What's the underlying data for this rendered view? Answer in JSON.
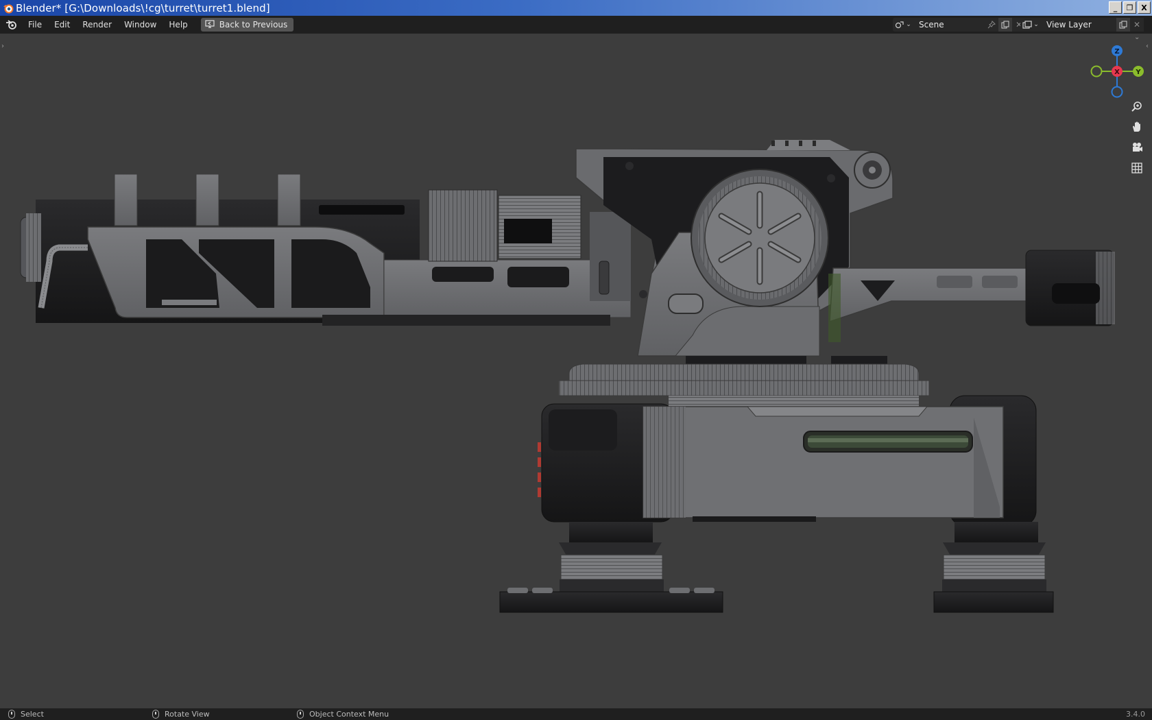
{
  "window": {
    "title": "Blender* [G:\\Downloads\\!cg\\turret\\turret1.blend]",
    "controls": {
      "minimize": "_",
      "restore": "❐",
      "close": "X"
    }
  },
  "topbar": {
    "menus": [
      "File",
      "Edit",
      "Render",
      "Window",
      "Help"
    ],
    "back_button": "Back to Previous",
    "scene": {
      "value": "Scene"
    },
    "view_layer": {
      "value": "View Layer"
    }
  },
  "viewport": {
    "gizmo": {
      "x": "X",
      "y": "Y",
      "z": "Z"
    },
    "nav_icons": [
      "zoom-icon",
      "hand-pan-icon",
      "camera-icon",
      "grid-ortho-icon"
    ],
    "colors": {
      "x_axis": "#e8384f",
      "y_axis": "#8bbc2c",
      "z_axis": "#2e7ad6",
      "background": "#3d3d3d"
    }
  },
  "statusbar": {
    "left_click": "Select",
    "middle_click": "Rotate View",
    "right_click": "Object Context Menu",
    "version": "3.4.0"
  }
}
